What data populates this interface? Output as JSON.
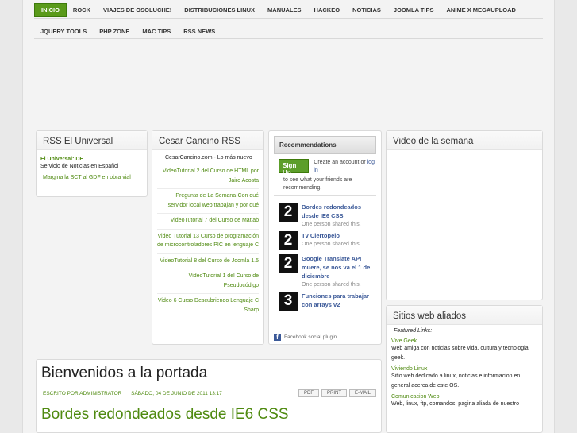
{
  "nav": {
    "row1": [
      "Inicio",
      "Rock",
      "Viajes de Osoluche!",
      "Distribuciones Linux",
      "Manuales",
      "Hackeo",
      "Noticias",
      "Joomla Tips",
      "Anime x Megaupload"
    ],
    "row2": [
      "jquery tools",
      "PHP zone",
      "Mac Tips",
      "RSS News"
    ]
  },
  "rss_universal": {
    "title": "RSS El Universal",
    "source": "El Universal: DF",
    "description": "Servicio de Noticias en Español",
    "items": [
      "Margina la SCT al GDF en obra vial"
    ]
  },
  "rss_cesar": {
    "title": "Cesar Cancino RSS",
    "header": "CesarCancino.com - Lo más nuevo",
    "items": [
      "VideoTutorial 2 del Curso de HTML por Jairo Acosta",
      "Pregunta de La Semana-Con qué servidor local web trabajan y por qué",
      "VideoTutorial 7 del Curso de Matlab",
      "Video Tutorial 13 Curso de programación de microcontroladores PIC en lenguaje C",
      "VideoTutorial 8 del Curso de Joomla 1.5",
      "VideoTutorial 1 del Curso de Pseudocódigo",
      "Video 6 Curso Descubriendo Lenguaje C Sharp"
    ]
  },
  "recommend": {
    "title": "Recommendations",
    "signup": "Sign Up",
    "create": "Create an account or",
    "login": "log in",
    "see": "to see what your friends are recommending.",
    "items": [
      {
        "thumb": "2",
        "title": "Bordes redondeados desde IE6 CSS",
        "shared": "One person shared this."
      },
      {
        "thumb": "2",
        "title": "Tv Ciertopelo",
        "shared": "One person shared this."
      },
      {
        "thumb": "2",
        "title": "Google Translate API muere, se nos va el 1 de diciembre",
        "shared": "One person shared this."
      },
      {
        "thumb": "3",
        "title": "Funciones para trabajar con arrays v2",
        "shared": ""
      }
    ],
    "footer": "Facebook social plugin"
  },
  "video": {
    "title": "Video de la semana"
  },
  "sitios": {
    "title": "Sitios web aliados",
    "featured": "Featured Links:",
    "sites": [
      {
        "name": "Vive Geek",
        "desc": "Web amiga con noticias sobre vida, cultura y tecnologia geek."
      },
      {
        "name": "Viviendo Linux",
        "desc": "Sitio web dedicado a linux, noticias e informacion en general acerca de este OS."
      },
      {
        "name": "Comunicacion Web",
        "desc": "Web, linux, ftp, comandos, pagina aliada de nuestro"
      }
    ]
  },
  "article": {
    "title": "Bienvenidos a la portada",
    "author": "Escrito por Administrator",
    "date": "Sábado, 04 de Junio de 2011 13:17",
    "buttons": [
      "PDF",
      "Print",
      "E-mail"
    ],
    "post_title": "Bordes redondeados desde IE6 CSS"
  }
}
